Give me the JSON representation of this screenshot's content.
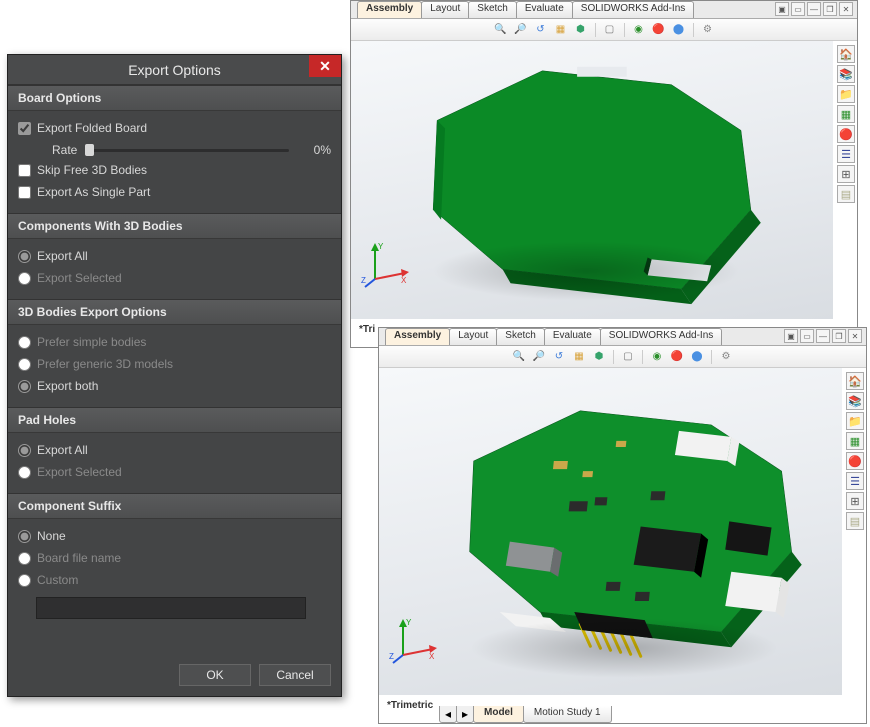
{
  "dialog": {
    "title": "Export Options",
    "boardOptions": {
      "header": "Board Options",
      "exportFolded": "Export Folded Board",
      "rateLabel": "Rate",
      "rateValue": "0%",
      "skipFree3d": "Skip Free 3D Bodies",
      "exportSinglePart": "Export As Single Part"
    },
    "componentsWith3d": {
      "header": "Components With 3D Bodies",
      "exportAll": "Export All",
      "exportSelected": "Export Selected"
    },
    "bodies3d": {
      "header": "3D Bodies Export Options",
      "preferSimple": "Prefer simple bodies",
      "preferGeneric": "Prefer generic 3D models",
      "exportBoth": "Export both"
    },
    "padHoles": {
      "header": "Pad Holes",
      "exportAll": "Export All",
      "exportSelected": "Export Selected"
    },
    "componentSuffix": {
      "header": "Component Suffix",
      "none": "None",
      "boardFile": "Board file name",
      "custom": "Custom"
    },
    "buttons": {
      "ok": "OK",
      "cancel": "Cancel"
    }
  },
  "solidworks": {
    "tabs": [
      "Assembly",
      "Layout",
      "Sketch",
      "Evaluate",
      "SOLIDWORKS Add-Ins"
    ],
    "bottomTabs": [
      "Model",
      "Motion Study 1"
    ],
    "viewLabel1": "*Tri",
    "viewLabel2": "*Trimetric"
  }
}
